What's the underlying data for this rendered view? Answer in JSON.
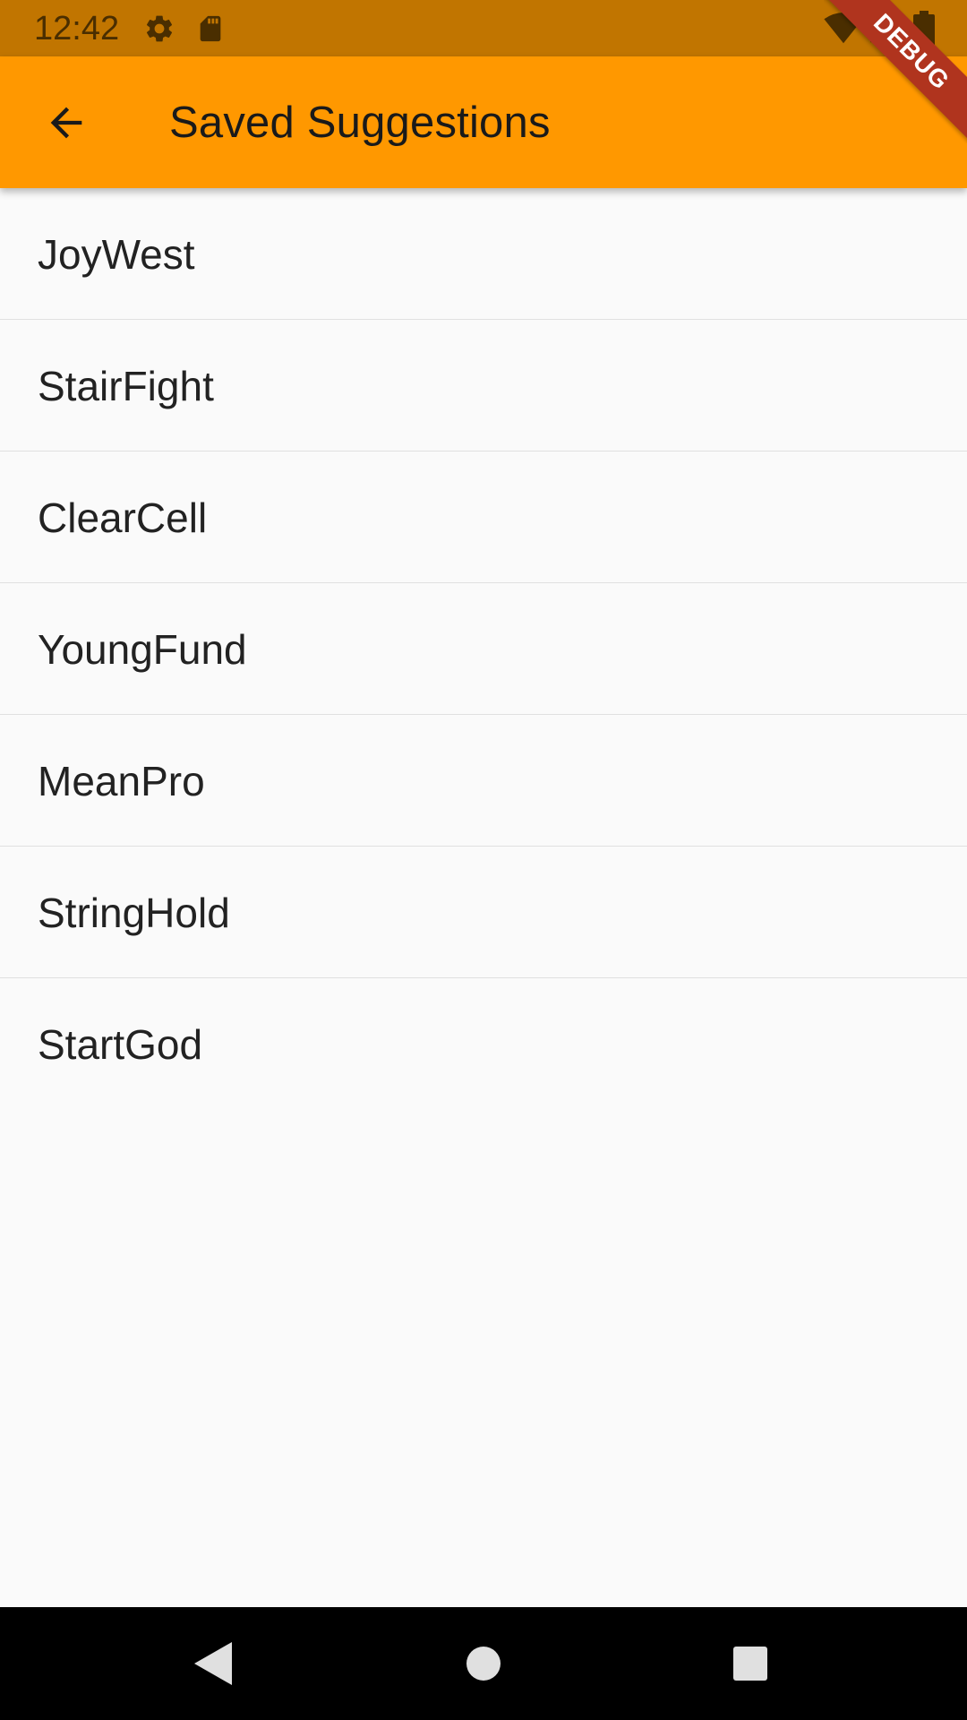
{
  "status_bar": {
    "time": "12:42",
    "icons": [
      "settings-icon",
      "sd-card-icon",
      "wifi-icon",
      "signal-icon",
      "battery-icon"
    ]
  },
  "app_bar": {
    "title": "Saved Suggestions",
    "back_icon": "arrow-back-icon",
    "background_color": "#ff9800"
  },
  "debug_banner": {
    "label": "DEBUG"
  },
  "saved_list": {
    "items": [
      {
        "label": "JoyWest"
      },
      {
        "label": "StairFight"
      },
      {
        "label": "ClearCell"
      },
      {
        "label": "YoungFund"
      },
      {
        "label": "MeanPro"
      },
      {
        "label": "StringHold"
      },
      {
        "label": "StartGod"
      }
    ]
  },
  "nav_bar": {
    "buttons": [
      "nav-back-icon",
      "nav-home-icon",
      "nav-recents-icon"
    ]
  }
}
